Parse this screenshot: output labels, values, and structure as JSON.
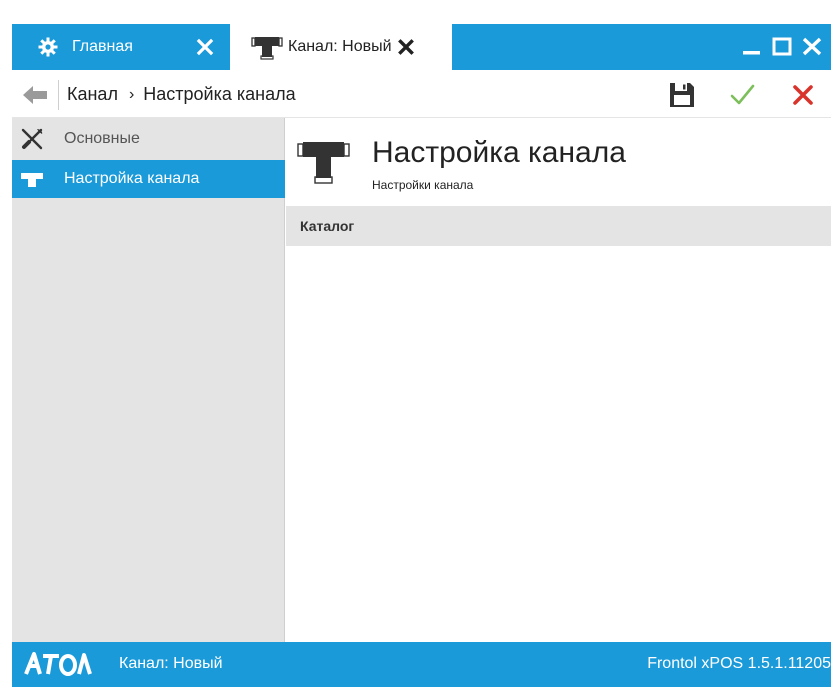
{
  "tabs": {
    "main": {
      "label": "Главная",
      "icon": "gear-icon"
    },
    "channel": {
      "label": "Канал: Новый",
      "icon": "channel-icon"
    }
  },
  "window_controls": {
    "minimize": "minimize-icon",
    "maximize": "maximize-icon",
    "close": "close-icon"
  },
  "breadcrumb": {
    "items": [
      "Канал",
      "Настройка канала"
    ],
    "separator": "›"
  },
  "toolbar": {
    "save": "save-icon",
    "ok": "check-icon",
    "cancel": "close-icon"
  },
  "sidebar": {
    "items": [
      {
        "label": "Основные",
        "icon": "tools-icon",
        "selected": false
      },
      {
        "label": "Настройка канала",
        "icon": "channel-icon",
        "selected": true
      }
    ]
  },
  "main": {
    "title": "Настройка канала",
    "subtitle": "Настройки канала",
    "section": "Каталог"
  },
  "statusbar": {
    "logo": "АТОЛ",
    "document": "Канал: Новый",
    "version": "Frontol xPOS 1.5.1.11205"
  },
  "colors": {
    "accent": "#1b9ad9",
    "sidebar_bg": "#e4e4e4",
    "ok": "#7cbf5b",
    "cancel": "#d9342b"
  }
}
